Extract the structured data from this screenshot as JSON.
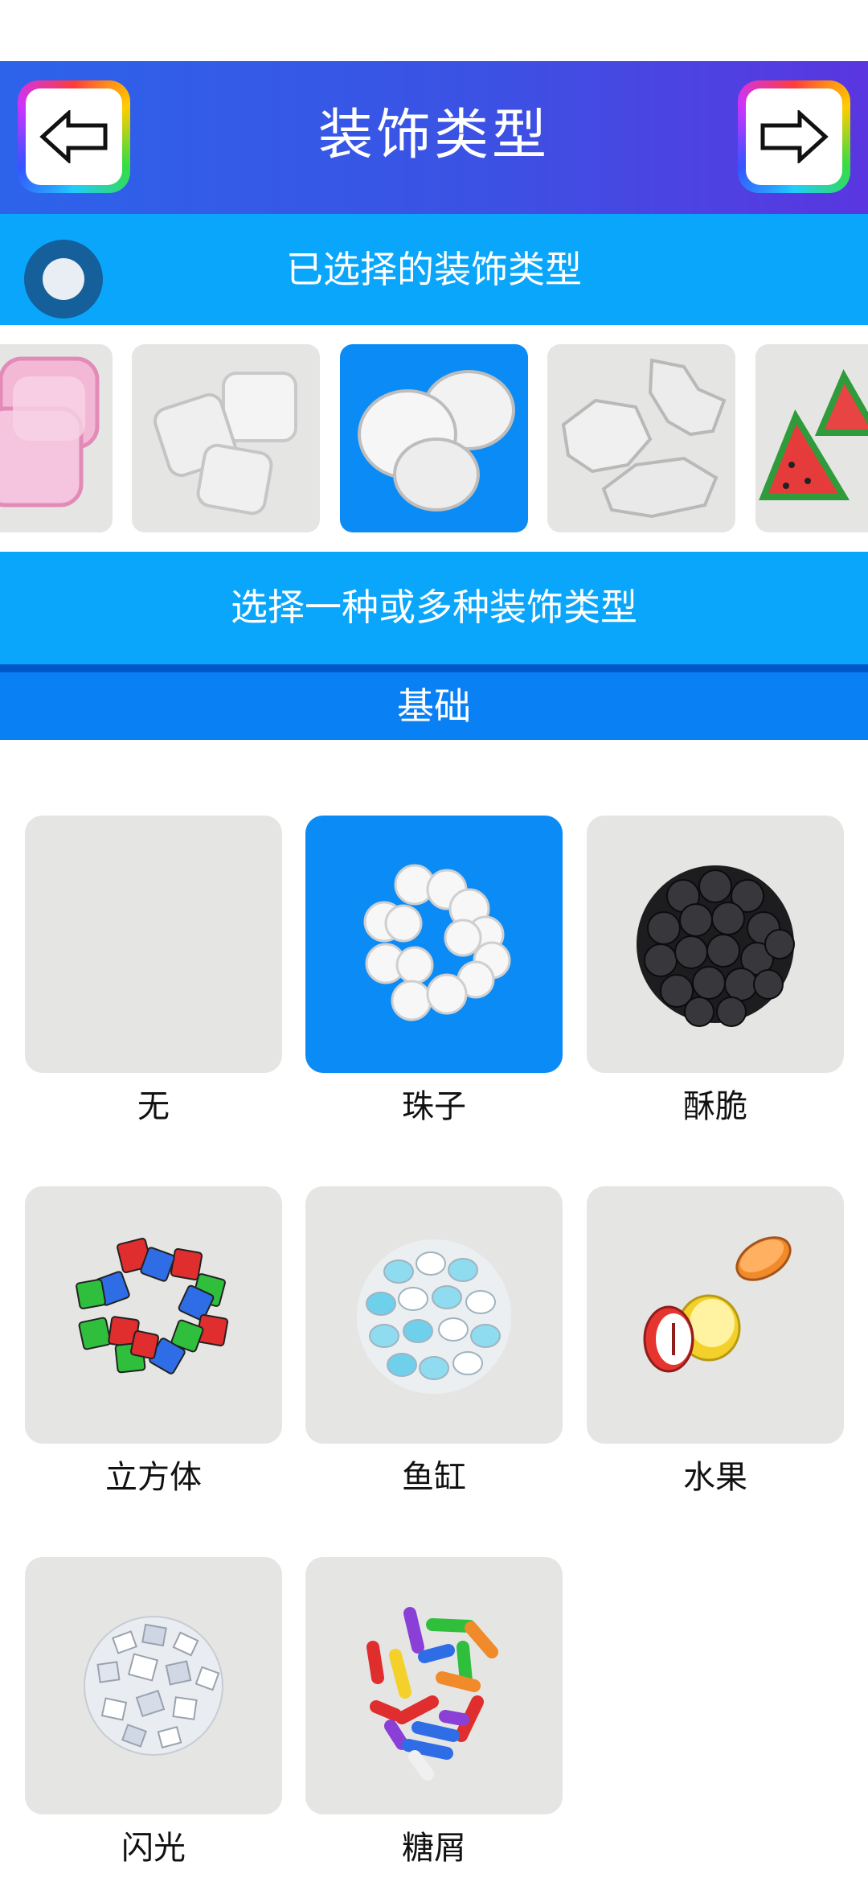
{
  "header": {
    "title": "装饰类型",
    "back_icon": "arrow-left-icon",
    "next_icon": "arrow-right-icon"
  },
  "selected_bar": {
    "label": "已选择的装饰类型"
  },
  "carousel": {
    "items": [
      {
        "name": "pink-gummy",
        "active": false
      },
      {
        "name": "white-cubes",
        "active": false
      },
      {
        "name": "white-marshmallows",
        "active": true
      },
      {
        "name": "white-crumbs",
        "active": false
      },
      {
        "name": "watermelon",
        "active": false
      }
    ]
  },
  "choose_bar": {
    "label": "选择一种或多种装饰类型"
  },
  "section": {
    "label": "基础"
  },
  "grid": {
    "items": [
      {
        "label": "无",
        "active": false
      },
      {
        "label": "珠子",
        "active": true
      },
      {
        "label": "酥脆",
        "active": false
      },
      {
        "label": "立方体",
        "active": false
      },
      {
        "label": "鱼缸",
        "active": false
      },
      {
        "label": "水果",
        "active": false
      },
      {
        "label": "闪光",
        "active": false
      },
      {
        "label": "糖屑",
        "active": false
      }
    ]
  },
  "colors": {
    "header_start": "#2d63ea",
    "header_end": "#5a36e0",
    "bar_blue": "#0aa6fb",
    "section_blue": "#0a80f5",
    "active_blue": "#0a8bf5",
    "tile_gray": "#e5e5e3"
  }
}
